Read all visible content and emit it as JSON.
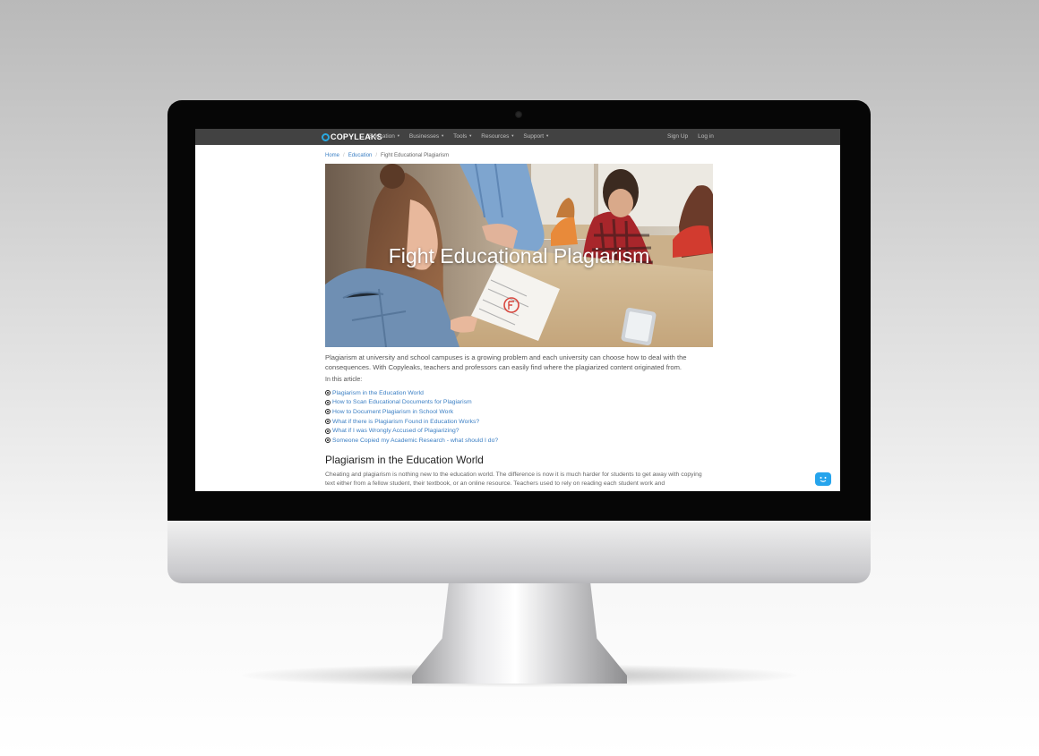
{
  "nav": {
    "brand": "COPYLEAKS",
    "items": [
      {
        "label": "Education"
      },
      {
        "label": "Businesses"
      },
      {
        "label": "Tools"
      },
      {
        "label": "Resources"
      },
      {
        "label": "Support"
      }
    ],
    "signup": "Sign Up",
    "login": "Log in"
  },
  "breadcrumb": [
    "Home",
    "Education",
    "Fight Educational Plagiarism"
  ],
  "hero": {
    "title": "Fight Educational Plagiarism"
  },
  "intro": "Plagiarism at university and school campuses is a growing problem and each university can choose how to deal with the consequences. With Copyleaks, teachers and professors can easily find where the plagiarized content originated from.",
  "in_this_article": "In this article:",
  "toc": [
    "Plagiarism in the Education World",
    "How to Scan Educational Documents for Plagiarism",
    "How to Document Plagiarism in School Work",
    "What if there is Plagiarism Found in Education Works?",
    "What if I was Wrongly Accused of Plagiarizing?",
    "Someone Copied my Academic Research - what should I do?"
  ],
  "section": {
    "heading": "Plagiarism in the Education World",
    "text": "Cheating and plagiarism is nothing new to the education world. The difference is now it is much harder for students to get away with copying text either from a fellow student, their textbook, or an online resource. Teachers used to rely on reading each student work and"
  },
  "colors": {
    "nav_bg": "#424242",
    "link": "#3b7fc4",
    "brand_accent": "#29a9e1",
    "chat": "#26a4ec"
  },
  "icons": {
    "chat": "chat-bot-icon",
    "toc_bullet": "circle-dot-icon",
    "caret": "caret-down-icon"
  }
}
